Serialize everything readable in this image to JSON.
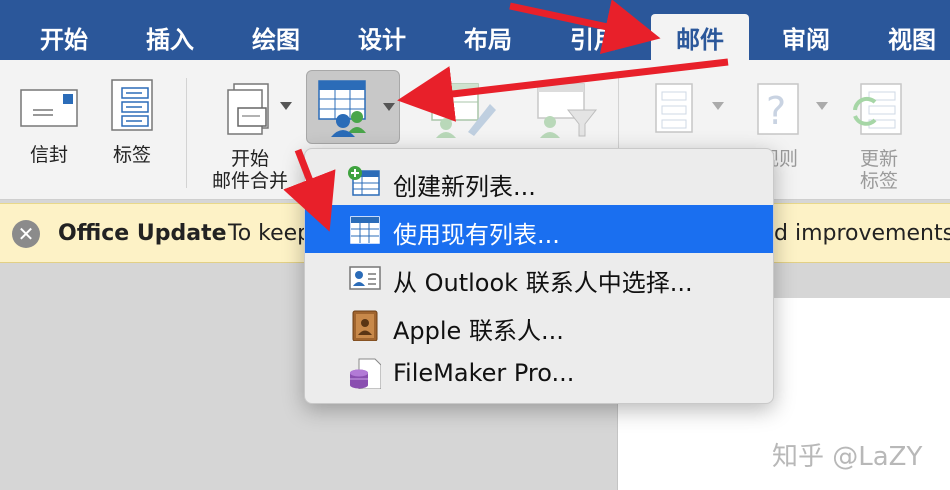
{
  "tabs": [
    {
      "label": "开始"
    },
    {
      "label": "插入"
    },
    {
      "label": "绘图"
    },
    {
      "label": "设计"
    },
    {
      "label": "布局"
    },
    {
      "label": "引用"
    },
    {
      "label": "邮件",
      "active": true
    },
    {
      "label": "审阅"
    },
    {
      "label": "视图"
    }
  ],
  "ribbon": {
    "envelopes": "信封",
    "labels": "标签",
    "start_merge_line1": "开始",
    "start_merge_line2": "邮件合并",
    "rules_partial": "规则",
    "update_labels_line1": "更新",
    "update_labels_line2": "标签"
  },
  "update_bar": {
    "title": "Office Update",
    "text": "To keep",
    "tail": "d improvements,"
  },
  "menu": {
    "items": [
      {
        "label": "创建新列表...",
        "icon": "new-list-icon"
      },
      {
        "label": "使用现有列表...",
        "icon": "existing-list-icon",
        "active": true
      },
      {
        "label": "从 Outlook 联系人中选择...",
        "icon": "outlook-contacts-icon"
      },
      {
        "label": "Apple 联系人...",
        "icon": "apple-contacts-icon"
      },
      {
        "label": "FileMaker Pro...",
        "icon": "filemaker-icon"
      }
    ]
  },
  "watermark": "知乎 @LaZY",
  "colors": {
    "tabbar": "#2b579a",
    "highlight": "#1a6ff0",
    "arrow": "#e8202a",
    "update_bar": "#fdf2c6"
  }
}
